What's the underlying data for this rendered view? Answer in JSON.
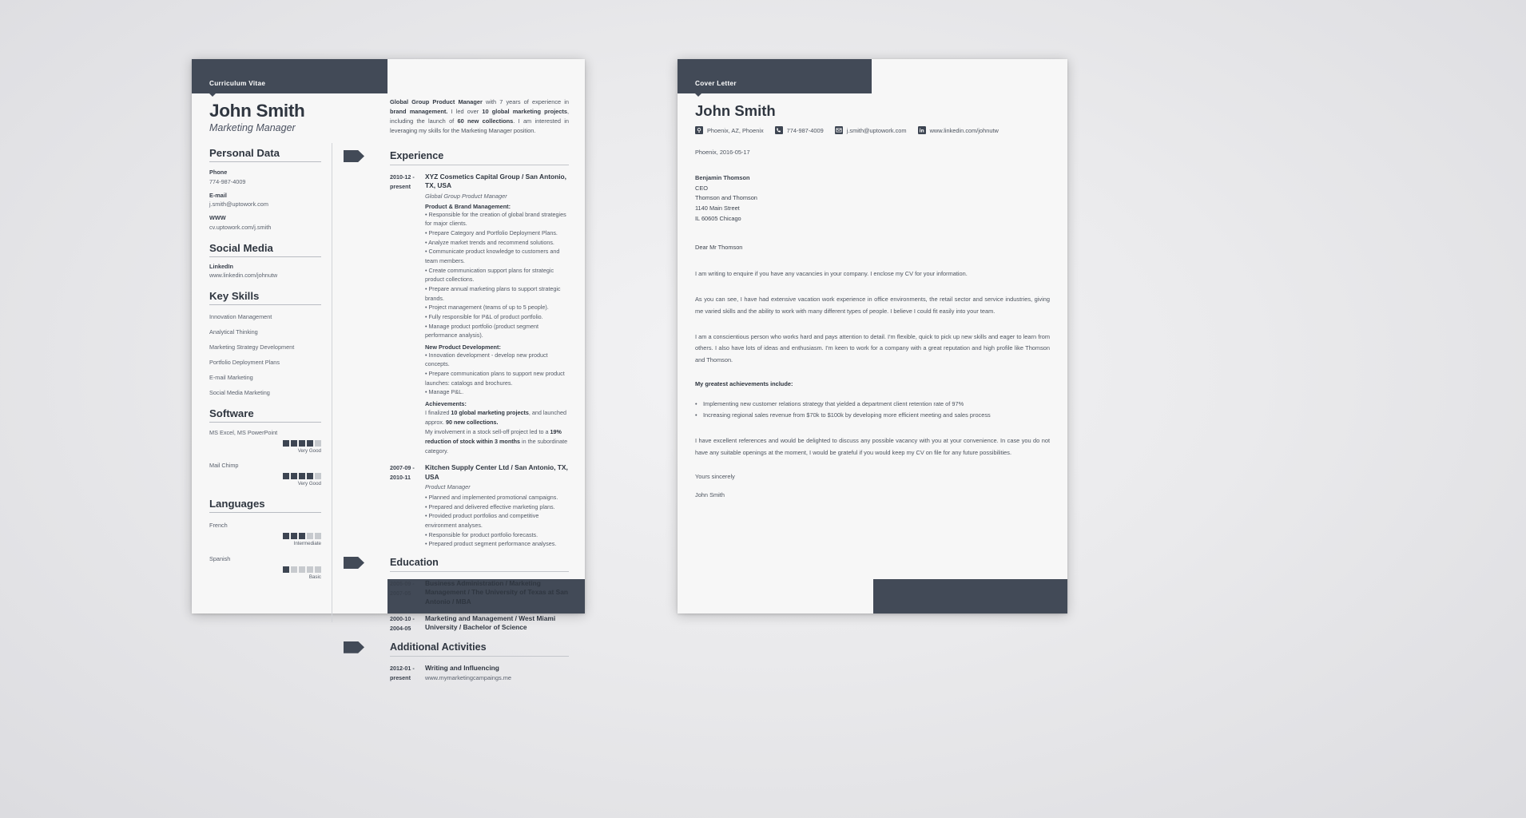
{
  "cv": {
    "header_label": "Curriculum Vitae",
    "name": "John Smith",
    "role": "Marketing Manager",
    "sections": {
      "personal_data": {
        "title": "Personal Data",
        "fields": [
          {
            "label": "Phone",
            "value": "774-987-4009"
          },
          {
            "label": "E-mail",
            "value": "j.smith@uptowork.com"
          },
          {
            "label": "WWW",
            "value": "cv.uptowork.com/j.smith"
          }
        ]
      },
      "social_media": {
        "title": "Social Media",
        "fields": [
          {
            "label": "LinkedIn",
            "value": "www.linkedin.com/johnutw"
          }
        ]
      },
      "key_skills": {
        "title": "Key Skills",
        "items": [
          "Innovation Management",
          "Analytical Thinking",
          "Marketing Strategy Development",
          "Portfolio Deployment Plans",
          "E-mail Marketing",
          "Social Media Marketing"
        ]
      },
      "software": {
        "title": "Software",
        "items": [
          {
            "name": "MS Excel, MS PowerPoint",
            "level": 4,
            "max": 5,
            "caption": "Very Good"
          },
          {
            "name": "Mail Chimp",
            "level": 4,
            "max": 5,
            "caption": "Very Good"
          }
        ]
      },
      "languages": {
        "title": "Languages",
        "items": [
          {
            "name": "French",
            "level": 3,
            "max": 5,
            "caption": "Intermediate"
          },
          {
            "name": "Spanish",
            "level": 1,
            "max": 5,
            "caption": "Basic"
          }
        ]
      }
    },
    "summary": {
      "part1_bold": "Global Group Product Manager",
      "part2": " with 7 years of experience in ",
      "part3_bold": "brand management.",
      "part4": " I led over ",
      "part5_bold": "10 global marketing projects",
      "part6": ", including the launch of ",
      "part7_bold": "60 new collections",
      "part8": ". I am interested in leveraging my skills for the Marketing Manager position."
    },
    "experience": {
      "title": "Experience",
      "entries": [
        {
          "date": "2010-12 - present",
          "title": "XYZ Cosmetics Capital Group / San Antonio, TX, USA",
          "subtitle": "Global Group Product Manager",
          "group1_head": "Product & Brand Management:",
          "group1_bullets": [
            "• Responsible for the creation of global brand strategies for major clients.",
            "• Prepare Category and Portfolio Deployment Plans.",
            "• Analyze market trends and recommend solutions.",
            "• Communicate product knowledge to customers and team members.",
            "• Create communication support plans for strategic product collections.",
            "• Prepare annual marketing plans to support strategic brands.",
            "• Project management (teams of up to 5 people).",
            "• Fully responsible for P&L of product portfolio.",
            "• Manage product portfolio (product segment performance analysis)."
          ],
          "group2_head": "New Product Development:",
          "group2_bullets": [
            "• Innovation development - develop new product concepts.",
            "• Prepare communication plans to support new product launches: catalogs and brochures.",
            "• Manage P&L."
          ],
          "group3_head": "Achievements:",
          "ach1_a": "I finalized ",
          "ach1_b": "10 global marketing projects",
          "ach1_c": ", and launched approx. ",
          "ach1_d": "90 new collections.",
          "ach2_a": "My involvement in a stock sell-off project led to a ",
          "ach2_b": "19% reduction of stock within 3 months",
          "ach2_c": " in the subordinate category."
        },
        {
          "date": "2007-09 - 2010-11",
          "title": "Kitchen Supply Center Ltd / San Antonio, TX, USA",
          "subtitle": "Product Manager",
          "bullets": [
            "• Planned and implemented promotional campaigns.",
            "• Prepared and delivered effective marketing plans.",
            "• Provided product portfolios and competitive environment analyses.",
            "• Responsible for product portfolio forecasts.",
            "• Prepared product segment performance analyses."
          ]
        }
      ]
    },
    "education": {
      "title": "Education",
      "entries": [
        {
          "date": "2005-09 - 2007-05",
          "title": "Business Administration / Marketing Management / The University of Texas at San Antonio / MBA"
        },
        {
          "date": "2000-10 - 2004-05",
          "title": "Marketing and Management / West Miami University / Bachelor of Science"
        }
      ]
    },
    "additional_activities": {
      "title": "Additional Activities",
      "entries": [
        {
          "date": "2012-01 - present",
          "title": "Writing and Influencing",
          "subtitle": "www.mymarketingcampaings.me"
        }
      ]
    }
  },
  "cover_letter": {
    "header_label": "Cover Letter",
    "name": "John Smith",
    "contacts": [
      {
        "icon": "location-pin-icon",
        "text": "Phoenix, AZ, Phoenix"
      },
      {
        "icon": "phone-icon",
        "text": "774-987-4009"
      },
      {
        "icon": "envelope-icon",
        "text": "j.smith@uptowork.com"
      },
      {
        "icon": "linkedin-icon",
        "text": "www.linkedin.com/johnutw"
      }
    ],
    "date_line": "Phoenix, 2016-05-17",
    "recipient": {
      "name": "Benjamin Thomson",
      "title": "CEO",
      "company": "Thomson and Thomson",
      "street": "1140 Main Street",
      "city": "IL 60605 Chicago"
    },
    "salutation": "Dear Mr Thomson",
    "paragraphs": [
      "I am writing to enquire if you have any vacancies in your company. I enclose my CV for your information.",
      "As you can see, I have had extensive vacation work experience in office environments, the retail sector and service industries, giving me varied skills and the ability to work with many different types of people. I believe I could fit easily into your team.",
      "I am a conscientious person who works hard and pays attention to detail. I'm flexible, quick to pick up new skills and eager to learn from others. I also have lots of ideas and enthusiasm. I'm keen to work for a company with a great reputation and high profile like Thomson and Thomson."
    ],
    "achievements_head": "My greatest achievements include:",
    "achievements": [
      "Implementing new customer relations strategy that yielded a department client retention rate of 97%",
      "Increasing regional sales revenue from $70k to $100k by developing more efficient meeting and sales process"
    ],
    "closing_paragraph": "I have excellent references and would be delighted to discuss any possible vacancy with you at your convenience. In case you do not have any suitable openings at the moment, I would be grateful if you would keep my CV on file for any future possibilities.",
    "sign_off": "Yours sincerely",
    "signature": "John Smith"
  },
  "colors": {
    "dark": "#424a57",
    "paper": "#f7f7f7",
    "rule": "#c3c6cb",
    "rating_on": "#3d4552",
    "rating_off": "#c7cace"
  }
}
